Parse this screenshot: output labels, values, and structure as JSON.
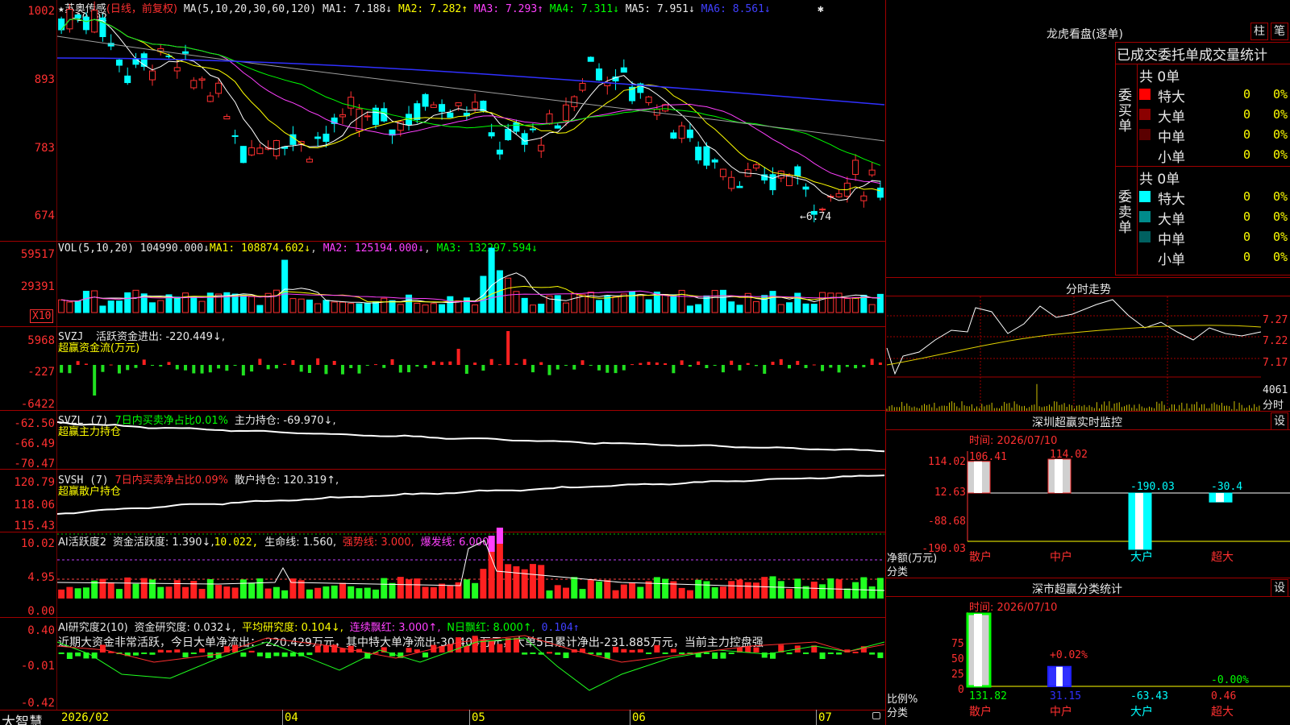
{
  "stock": {
    "star": "★",
    "name": "苏奥传感",
    "period": "(日线，前复权)",
    "high_marker": "←10.02",
    "low_marker": "←6.74"
  },
  "ma": {
    "label": "MA(5,10,20,30,60,120)",
    "ma1": "MA1: 7.188↓",
    "ma2": "MA2: 7.282↑",
    "ma3": "MA3: 7.293↑",
    "ma4": "MA4: 7.311↓",
    "ma5": "MA5: 7.951↓",
    "ma6": "MA6: 8.561↓",
    "arrows": "⇣ ⇣"
  },
  "price_axis": [
    "1002",
    "893",
    "783",
    "674"
  ],
  "vol": {
    "label": "VOL(5,10,20)",
    "value": "104990.000↓",
    "ma1": "MA1: 108874.602↓",
    "ma2": "MA2: 125194.000↓",
    "ma3": "MA3: 132297.594↓",
    "axis": [
      "59517",
      "29391"
    ],
    "unit": "X10"
  },
  "svzj": {
    "label": "SVZJ",
    "text": "活跃资金进出: -220.449↓,",
    "sub": "超赢资金流(万元)",
    "axis": [
      "5968",
      "-227",
      "-6422"
    ]
  },
  "svzl": {
    "label": "SVZL (7)",
    "pct": "7日内买卖净占比0.01%",
    "text": "主力持仓: -69.970↓,",
    "sub": "超赢主力持仓",
    "axis": [
      "-62.50",
      "-66.49",
      "-70.47"
    ]
  },
  "svsh": {
    "label": "SVSH (7)",
    "pct": "7日内买卖净占比0.09%",
    "text": "散户持仓: 120.319↑,",
    "sub": "超赢散户持仓",
    "axis": [
      "120.79",
      "118.06",
      "115.43"
    ]
  },
  "ai1": {
    "label": "AI活跃度2",
    "v1": "资金活跃度: 1.390↓,",
    "v2": "10.022,",
    "v3": "生命线: 1.560,",
    "v4": "强势线: 3.000,",
    "v5": "爆发线: 6.000,",
    "axis": [
      "10.02",
      "4.95",
      "0.00"
    ]
  },
  "ai2": {
    "label": "AI研究度2(10)",
    "v1": "资金研究度: 0.032↓,",
    "v2": "平均研究度: 0.104↓,",
    "v3": "连续飘红: 3.000↑,",
    "v4": "N日飘红: 8.000↑,",
    "v5": "0.104↑",
    "summary": "近期大资金非常活跃，今日大单净流出：-220.429万元，其中特大单净流出-30.404万元，大单5日累计净出-231.885万元，当前主力控盘强",
    "axis": [
      "0.40",
      "-0.01",
      "-0.42"
    ]
  },
  "dates": {
    "brand": "大智慧",
    "labels": [
      "2026/02",
      "04",
      "05",
      "06",
      "07"
    ]
  },
  "longhu": {
    "title": "龙虎看盘(逐单)",
    "btn1": "柱",
    "btn2": "笔",
    "subtitle": "已成交委托单成交量统计",
    "buy_label": [
      "委",
      "买",
      "单"
    ],
    "sell_label": [
      "委",
      "卖",
      "单"
    ],
    "buy": {
      "total": "共 0单",
      "rows": [
        {
          "name": "特大",
          "count": "0",
          "pct": "0%",
          "color": "#ff0000"
        },
        {
          "name": "大单",
          "count": "0",
          "pct": "0%",
          "color": "#8b0000"
        },
        {
          "name": "中单",
          "count": "0",
          "pct": "0%",
          "color": "#5a0000"
        },
        {
          "name": "小单",
          "count": "0",
          "pct": "0%",
          "color": "#000000"
        }
      ]
    },
    "sell": {
      "total": "共 0单",
      "rows": [
        {
          "name": "特大",
          "count": "0",
          "pct": "0%",
          "color": "#00ffff"
        },
        {
          "name": "大单",
          "count": "0",
          "pct": "0%",
          "color": "#008b8b"
        },
        {
          "name": "中单",
          "count": "0",
          "pct": "0%",
          "color": "#006060"
        },
        {
          "name": "小单",
          "count": "0",
          "pct": "0%",
          "color": "#000000"
        }
      ]
    }
  },
  "fenshi": {
    "title": "分时走势",
    "axis": [
      "7.27",
      "7.22",
      "7.17"
    ],
    "vol_top": "4061",
    "vol_label": "分时"
  },
  "sz_monitor": {
    "title": "深圳超赢实时监控",
    "btn": "设",
    "time": "时间: 2026/07/10",
    "axis": [
      "114.02",
      "12.63",
      "-88.68",
      "-190.03"
    ],
    "unit": "净额(万元)",
    "cat_label": "分类",
    "bars": [
      {
        "name": "散户",
        "value": "106.41"
      },
      {
        "name": "中户",
        "value": "114.02"
      },
      {
        "name": "大户",
        "value": "-190.03"
      },
      {
        "name": "超大",
        "value": "-30.4"
      }
    ]
  },
  "sz_class": {
    "title": "深市超赢分类统计",
    "btn": "设",
    "time": "时间: 2026/07/10",
    "axis": [
      "75",
      "50",
      "25",
      "0"
    ],
    "unit": "比例%",
    "cat_label": "分类",
    "bars": [
      {
        "name": "散户",
        "value": "131.82",
        "pct": ""
      },
      {
        "name": "中户",
        "value": "31.15",
        "pct": "+0.02%"
      },
      {
        "name": "大户",
        "value": "-63.43",
        "pct": ""
      },
      {
        "name": "超大",
        "value": "0.46",
        "pct": "-0.00%"
      }
    ]
  }
}
